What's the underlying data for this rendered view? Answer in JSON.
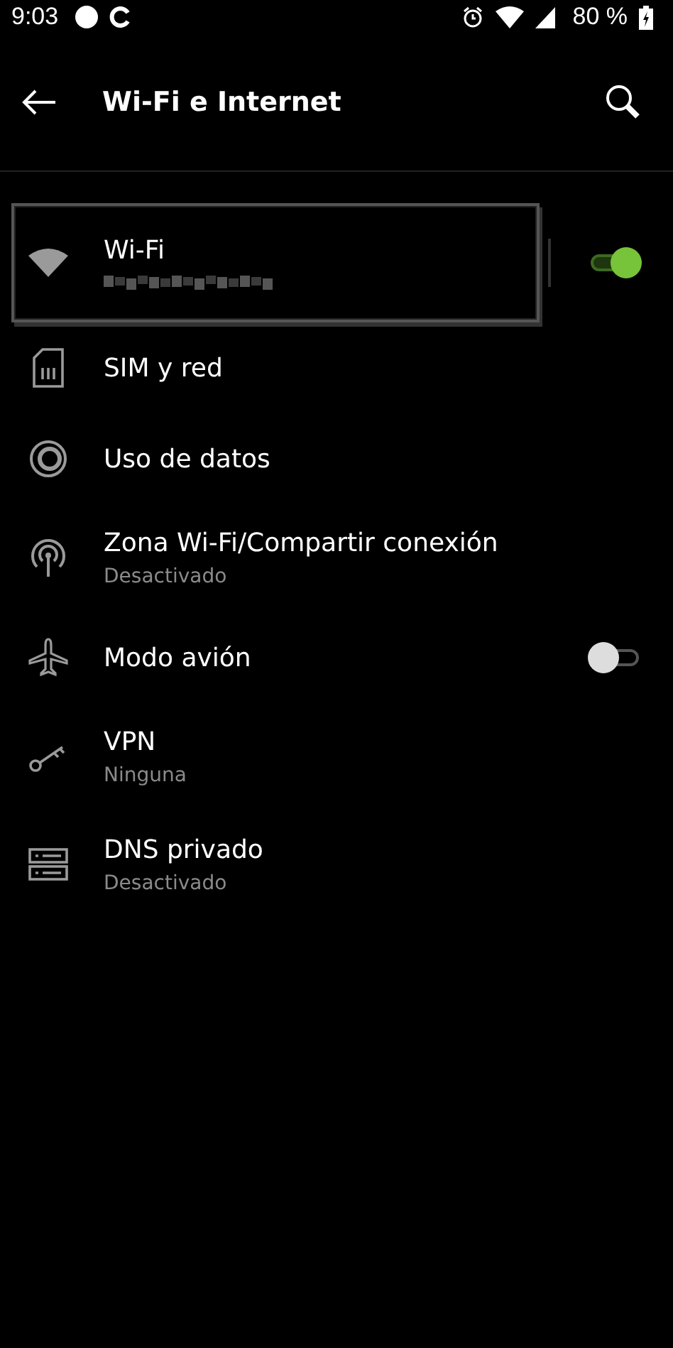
{
  "status_bar": {
    "time": "9:03",
    "battery": "80 %"
  },
  "app_bar": {
    "title": "Wi-Fi e Internet"
  },
  "items": [
    {
      "kind": "wifi",
      "title": "Wi-Fi",
      "subtitle_redacted": true,
      "on": true,
      "highlighted": true
    },
    {
      "kind": "sim",
      "title": "SIM y red",
      "highlighted": false
    },
    {
      "kind": "data",
      "title": "Uso de datos",
      "highlighted": false
    },
    {
      "kind": "hotspot",
      "title": "Zona Wi-Fi/Compartir conexión",
      "subtitle": "Desactivado",
      "highlighted": false
    },
    {
      "kind": "plane",
      "title": "Modo avión",
      "on": false,
      "highlighted": false
    },
    {
      "kind": "key",
      "title": "VPN",
      "subtitle": "Ninguna",
      "highlighted": false
    },
    {
      "kind": "dns",
      "title": "DNS privado",
      "subtitle": "Desactivado",
      "highlighted": false
    }
  ]
}
